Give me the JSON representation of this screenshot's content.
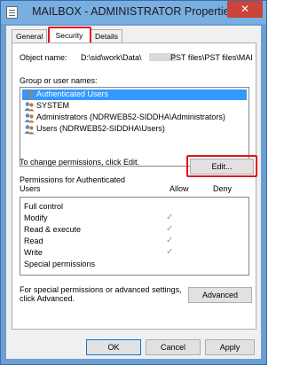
{
  "window": {
    "title": "MAILBOX - ADMINISTRATOR Properties",
    "close_glyph": "✕"
  },
  "tabs": [
    {
      "label": "General",
      "active": false
    },
    {
      "label": "Security",
      "active": true
    },
    {
      "label": "Details",
      "active": false
    }
  ],
  "security": {
    "object_name_label": "Object name:",
    "object_name_value": "D:\\sid\\work\\Data\\",
    "object_name_value_tail": "PST files\\PST files\\MAI",
    "group_label": "Group or user names:",
    "users": [
      {
        "label": "Authenticated Users",
        "selected": true,
        "icon": "users-group-icon"
      },
      {
        "label": "SYSTEM",
        "selected": false,
        "icon": "users-group-icon"
      },
      {
        "label": "Administrators (NDRWEB52-SIDDHA\\Administrators)",
        "selected": false,
        "icon": "users-group-icon"
      },
      {
        "label": "Users (NDRWEB52-SIDDHA\\Users)",
        "selected": false,
        "icon": "users-group-icon"
      }
    ],
    "change_text": "To change permissions, click Edit.",
    "edit_button": "Edit...",
    "permissions_label_line1": "Permissions for Authenticated",
    "permissions_label_line2": "Users",
    "allow_header": "Allow",
    "deny_header": "Deny",
    "permissions": [
      {
        "name": "Full control",
        "allow": false
      },
      {
        "name": "Modify",
        "allow": true
      },
      {
        "name": "Read & execute",
        "allow": true
      },
      {
        "name": "Read",
        "allow": true
      },
      {
        "name": "Write",
        "allow": true
      },
      {
        "name": "Special permissions",
        "allow": false
      }
    ],
    "check_glyph": "✓",
    "advanced_text_line1": "For special permissions or advanced settings,",
    "advanced_text_line2": "click Advanced.",
    "advanced_button": "Advanced"
  },
  "footer": {
    "ok": "OK",
    "cancel": "Cancel",
    "apply": "Apply"
  },
  "colors": {
    "selection": "#3399ff",
    "highlight_box": "#e2141f",
    "titlebar": "#79aee0",
    "close": "#c9453a"
  }
}
